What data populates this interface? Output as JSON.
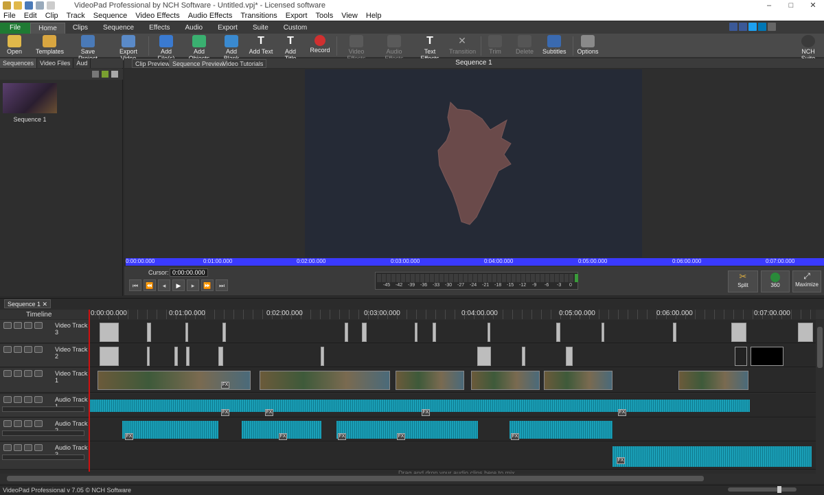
{
  "window": {
    "title": "VideoPad Professional by NCH Software - Untitled.vpj* - Licensed software",
    "controls": [
      "–",
      "□",
      "✕"
    ]
  },
  "menu": [
    "File",
    "Edit",
    "Clip",
    "Track",
    "Sequence",
    "Video Effects",
    "Audio Effects",
    "Transitions",
    "Export",
    "Tools",
    "View",
    "Help"
  ],
  "tabs": [
    "File",
    "Home",
    "Clips",
    "Sequence",
    "Effects",
    "Audio",
    "Export",
    "Suite",
    "Custom"
  ],
  "ribbon": {
    "open": "Open",
    "templates": "Templates",
    "save_project": "Save Project",
    "export_video": "Export Video",
    "add_files": "Add File(s)",
    "add_objects": "Add Objects",
    "add_blank": "Add Blank",
    "add_text": "Add Text",
    "add_title": "Add Title",
    "record": "Record",
    "video_effects": "Video Effects",
    "audio_effects": "Audio Effects",
    "text_effects": "Text Effects",
    "transition": "Transition",
    "trim": "Trim",
    "delete": "Delete",
    "subtitles": "Subtitles",
    "options": "Options",
    "nch_suite": "NCH Suite"
  },
  "left_panel": {
    "tabs": [
      "Sequences",
      "Video Files",
      "Aud"
    ],
    "items": [
      {
        "label": "Sequence 1"
      }
    ]
  },
  "preview": {
    "tabs": [
      "Clip Preview",
      "Sequence Preview",
      "Video Tutorials"
    ],
    "title": "Sequence 1",
    "ruler": [
      "0:00:00.000",
      "0:01:00.000",
      "0:02:00.000",
      "0:03:00.000",
      "0:04:00.000",
      "0:05:00.000",
      "0:06:00.000",
      "0:07:00.000"
    ],
    "cursor_label": "Cursor:",
    "cursor_value": "0:00:00.000",
    "meter_scale": [
      "-45",
      "-42",
      "-39",
      "-36",
      "-33",
      "-30",
      "-27",
      "-24",
      "-21",
      "-18",
      "-15",
      "-12",
      "-9",
      "-6",
      "-3",
      "0"
    ],
    "split": "Split",
    "btn_360": "360",
    "maximize": "Maximize"
  },
  "timeline": {
    "tab": "Sequence 1",
    "label": "Timeline",
    "ruler": [
      "0:00:00.000",
      "0:01:00.000",
      "0:02:00.000",
      "0:03:00.000",
      "0:04:00.000",
      "0:05:00.000",
      "0:06:00.000",
      "0:07:00.000"
    ],
    "tracks": [
      "Video Track 3",
      "Video Track 2",
      "Video Track 1",
      "Audio Track 1",
      "Audio Track 2",
      "Audio Track 3"
    ],
    "drag_hint": "Drag and drop your audio clips here to mix"
  },
  "status": "VideoPad Professional v 7.05 © NCH Software",
  "colors": {
    "accent": "#1f7a33",
    "waveform": "#1aa0b8",
    "ruler": "#3a3aff",
    "playhead": "#d01010"
  }
}
